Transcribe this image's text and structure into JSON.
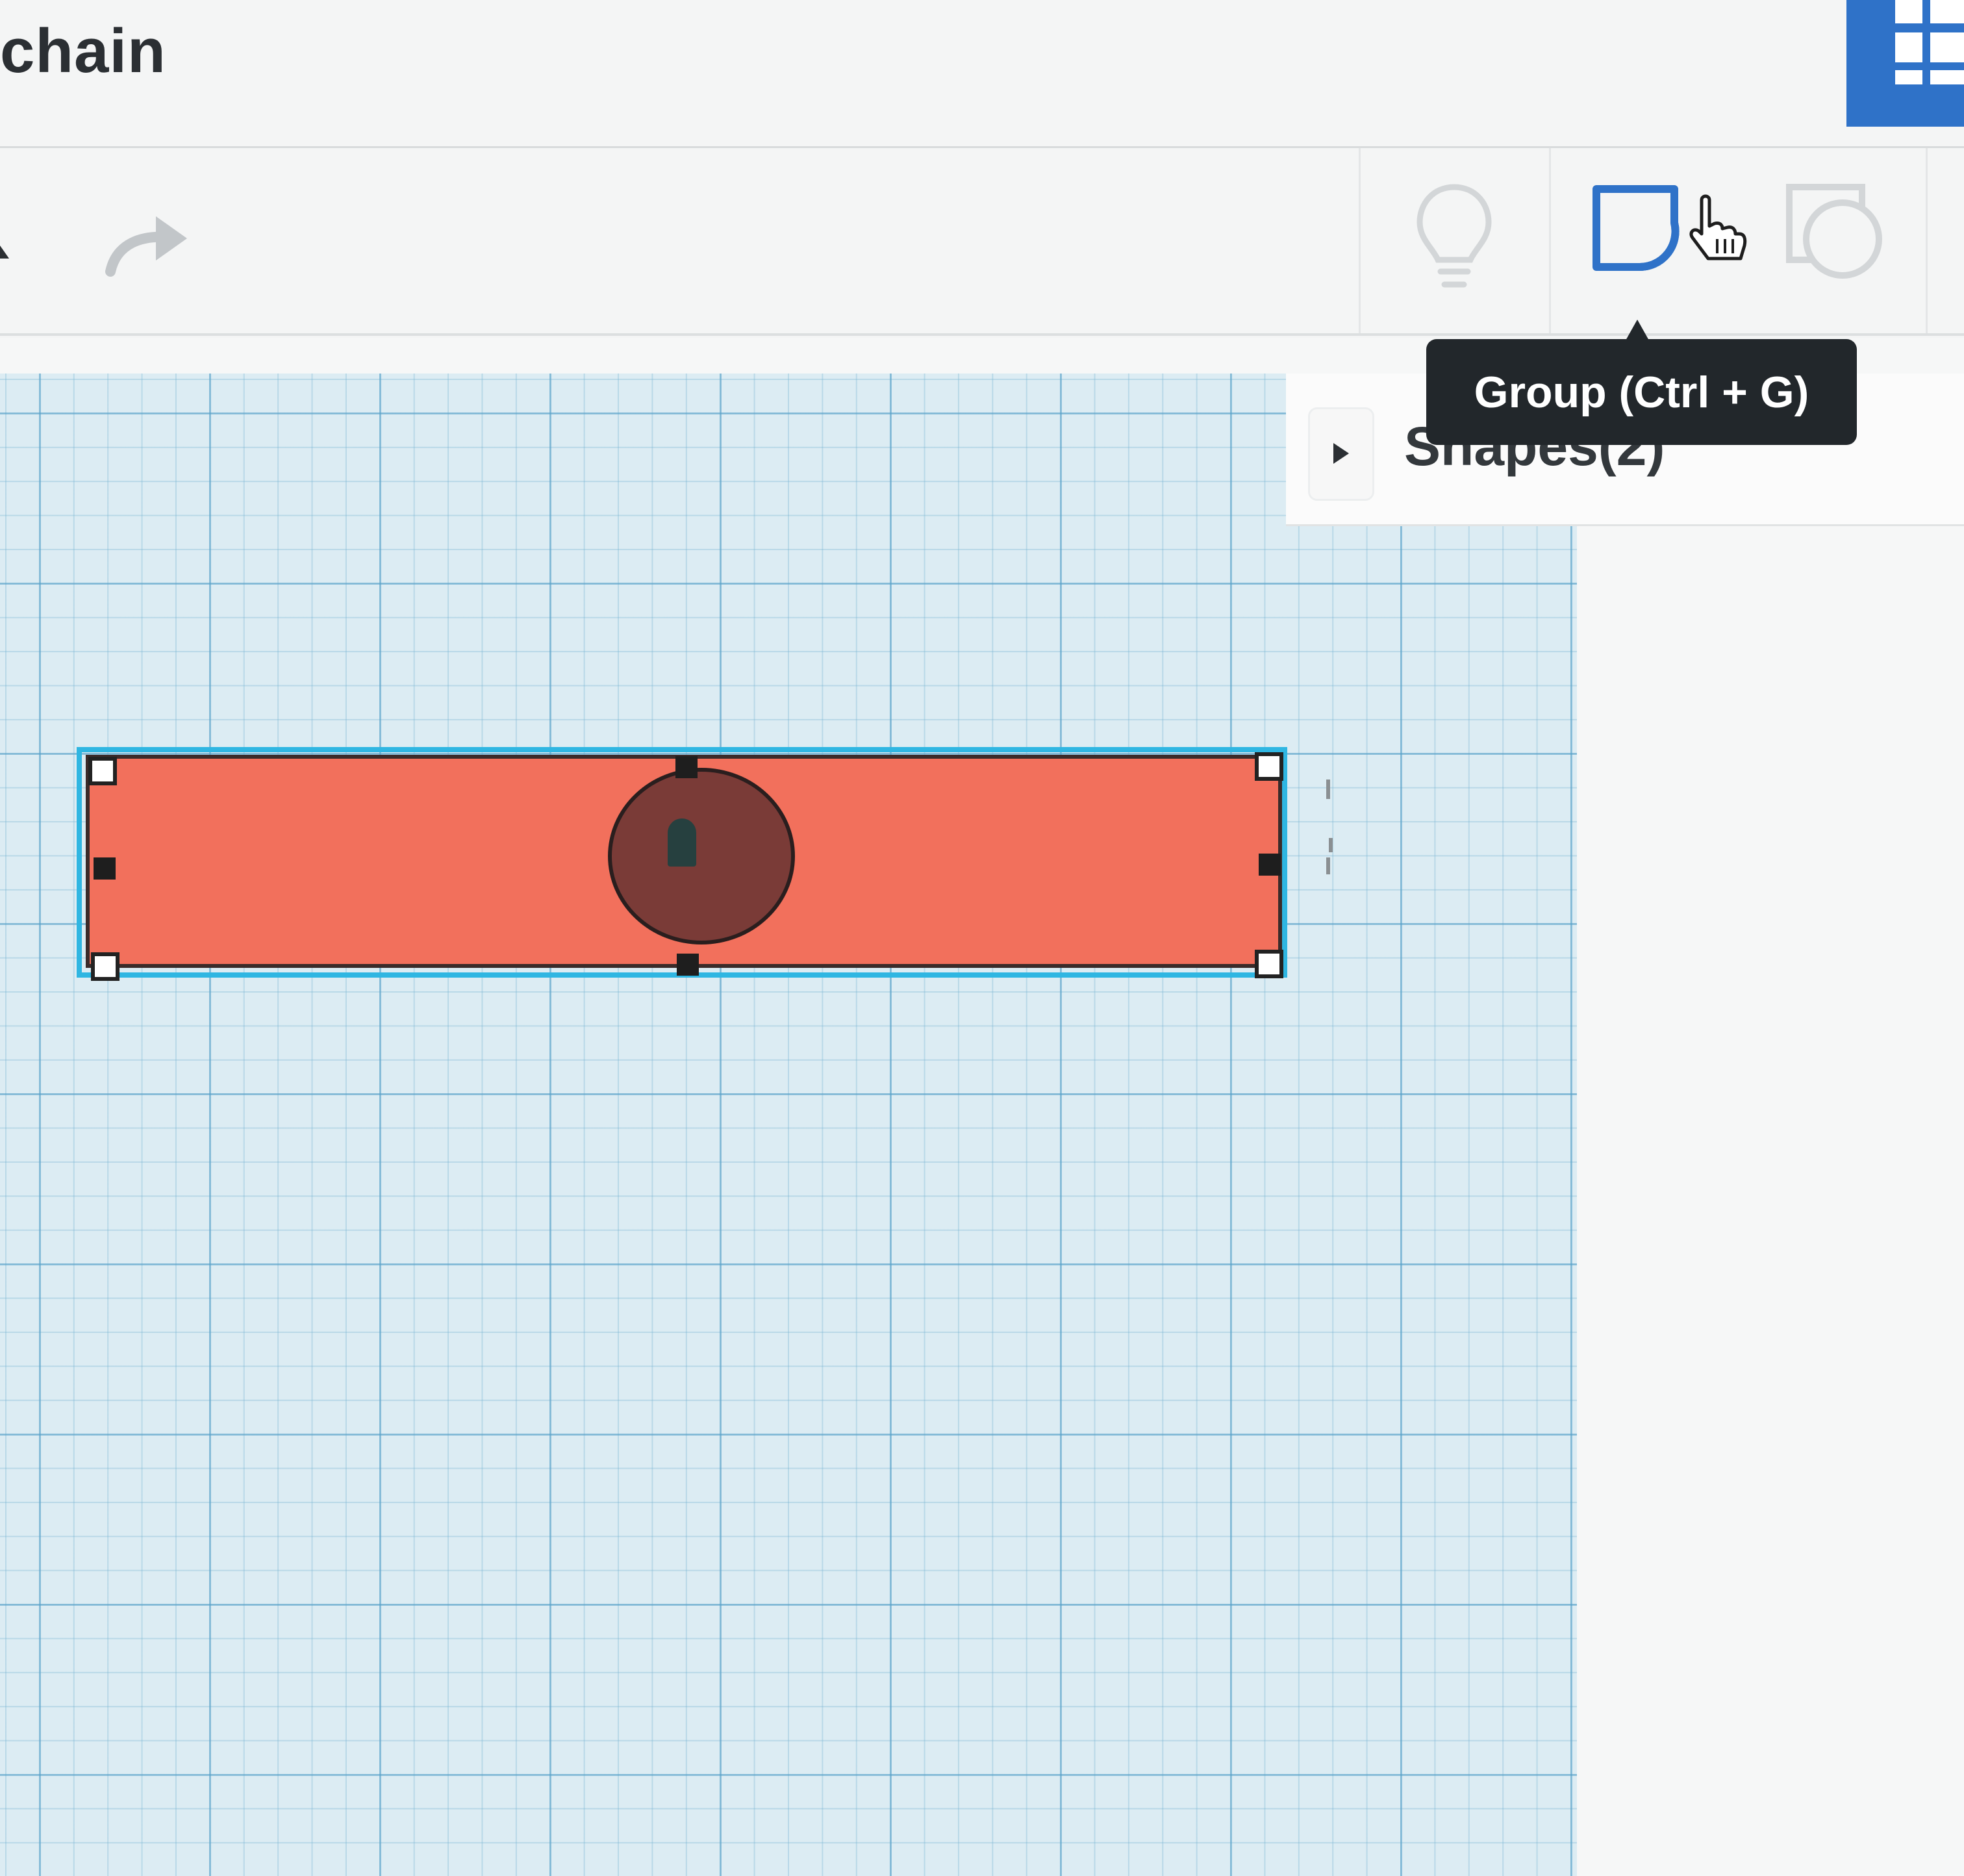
{
  "window": {
    "title": "chain"
  },
  "toolbar": {
    "redo_icon": "redo-arrow-icon",
    "notes_icon": "lightbulb-icon",
    "group_icon": "group-shapes-icon",
    "ungroup_icon": "ungroup-shapes-icon",
    "app_grid_icon": "app-grid-icon"
  },
  "tooltip": {
    "text": "Group (Ctrl + G)"
  },
  "shapes_panel": {
    "label": "Shapes(2)",
    "expanded": false
  },
  "workplane": {
    "shapes": [
      {
        "type": "box",
        "color": "#f2705c"
      },
      {
        "type": "cylinder-hole",
        "color": "#7a3b37"
      }
    ],
    "selection_color": "#2fb6e2"
  },
  "colors": {
    "accent": "#2f72c8",
    "tooltip_bg": "#22272b",
    "grid": "#dcecf3"
  }
}
